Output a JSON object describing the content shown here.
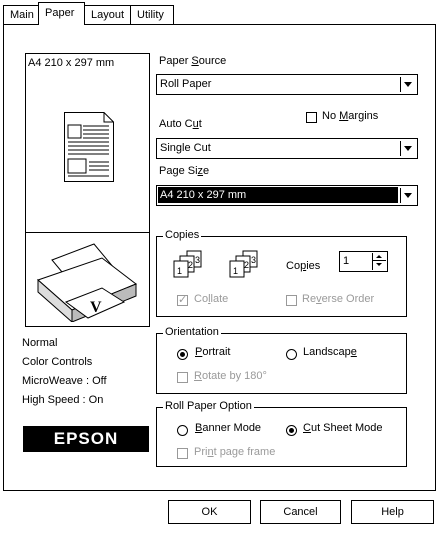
{
  "tabs": [
    {
      "label": "Main"
    },
    {
      "label": "Paper"
    },
    {
      "label": "Layout"
    },
    {
      "label": "Utility"
    }
  ],
  "preview": {
    "paper_label": "A4 210 x 297 mm"
  },
  "settings_summary": {
    "mode": "Normal",
    "color": "Color Controls",
    "microweave": "MicroWeave : Off",
    "high_speed": "High Speed : On"
  },
  "logo": "EPSON",
  "paper_source": {
    "label_pre": "Paper ",
    "label_key": "S",
    "label_post": "ource",
    "value": "Roll Paper"
  },
  "auto_cut": {
    "label_pre": "Auto C",
    "label_key": "u",
    "label_post": "t",
    "value": "Single Cut"
  },
  "no_margins": {
    "label_pre": "No ",
    "label_key": "M",
    "label_post": "argins",
    "checked": false
  },
  "page_size": {
    "label_pre": "Page Si",
    "label_key": "z",
    "label_post": "e",
    "value": "A4 210 x 297 mm"
  },
  "copies_group": {
    "title": "Copies",
    "copies_label_pre": "Co",
    "copies_label_key": "p",
    "copies_label_post": "ies",
    "copies_value": "1",
    "collate_pre": "Co",
    "collate_key": "l",
    "collate_post": "late",
    "collate_checked": true,
    "reverse_pre": "Re",
    "reverse_key": "v",
    "reverse_post": "erse Order",
    "reverse_checked": false
  },
  "orientation": {
    "title": "Orientation",
    "portrait_key": "P",
    "portrait_post": "ortrait",
    "landscape_pre": "Landscap",
    "landscape_key": "e",
    "selected": "portrait",
    "rotate_key": "R",
    "rotate_post": "otate by 180°"
  },
  "roll_paper_option": {
    "title": "Roll Paper Option",
    "banner_key": "B",
    "banner_post": "anner Mode",
    "cut_key": "C",
    "cut_post": "ut Sheet Mode",
    "selected": "cut_sheet",
    "print_frame_pre": "Pri",
    "print_frame_key": "n",
    "print_frame_post": "t page frame"
  },
  "buttons": {
    "ok": "OK",
    "cancel": "Cancel",
    "help": "Help"
  }
}
